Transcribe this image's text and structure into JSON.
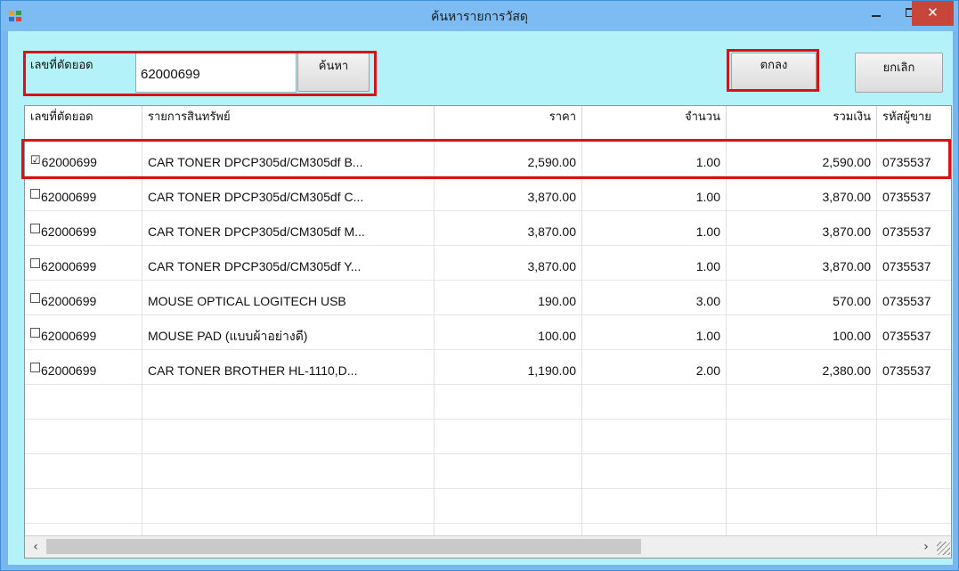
{
  "window": {
    "title": "ค้นหารายการวัสดุ",
    "icons": {
      "app": "app-window-icon",
      "minimize": "minimize-icon",
      "maximize": "maximize-icon",
      "close": "close-icon"
    },
    "close_glyph": "✕"
  },
  "search": {
    "label": "เลขที่ตัดยอด",
    "value": "62000699",
    "search_button": "ค้นหา"
  },
  "actions": {
    "ok": "ตกลง",
    "cancel": "ยกเลิก"
  },
  "table": {
    "columns": [
      "เลขที่ตัดยอด",
      "รายการสินทรัพย์",
      "ราคา",
      "จำนวน",
      "รวมเงิน",
      "รหัสผู้ขาย"
    ],
    "rows": [
      {
        "checked": true,
        "check": "☑",
        "doc": "62000699",
        "item": "CAR TONER DPCP305d/CM305df B...",
        "price": "2,590.00",
        "qty": "1.00",
        "total": "2,590.00",
        "vendor": "0735537"
      },
      {
        "checked": false,
        "check": "",
        "doc": "62000699",
        "item": "CAR TONER DPCP305d/CM305df C...",
        "price": "3,870.00",
        "qty": "1.00",
        "total": "3,870.00",
        "vendor": "0735537"
      },
      {
        "checked": false,
        "check": "",
        "doc": "62000699",
        "item": "CAR TONER DPCP305d/CM305df M...",
        "price": "3,870.00",
        "qty": "1.00",
        "total": "3,870.00",
        "vendor": "0735537"
      },
      {
        "checked": false,
        "check": "",
        "doc": "62000699",
        "item": "CAR TONER DPCP305d/CM305df Y...",
        "price": "3,870.00",
        "qty": "1.00",
        "total": "3,870.00",
        "vendor": "0735537"
      },
      {
        "checked": false,
        "check": "",
        "doc": "62000699",
        "item": "MOUSE OPTICAL LOGITECH USB",
        "price": "190.00",
        "qty": "3.00",
        "total": "570.00",
        "vendor": "0735537"
      },
      {
        "checked": false,
        "check": "",
        "doc": "62000699",
        "item": "MOUSE PAD (แบบผ้าอย่างดี)",
        "price": "100.00",
        "qty": "1.00",
        "total": "100.00",
        "vendor": "0735537"
      },
      {
        "checked": false,
        "check": "",
        "doc": "62000699",
        "item": "CAR TONER BROTHER HL-1110,D...",
        "price": "1,190.00",
        "qty": "2.00",
        "total": "2,380.00",
        "vendor": "0735537"
      }
    ]
  },
  "scrollbar": {
    "left_arrow": "‹",
    "right_arrow": "›"
  },
  "highlight_color": "#dd1111"
}
